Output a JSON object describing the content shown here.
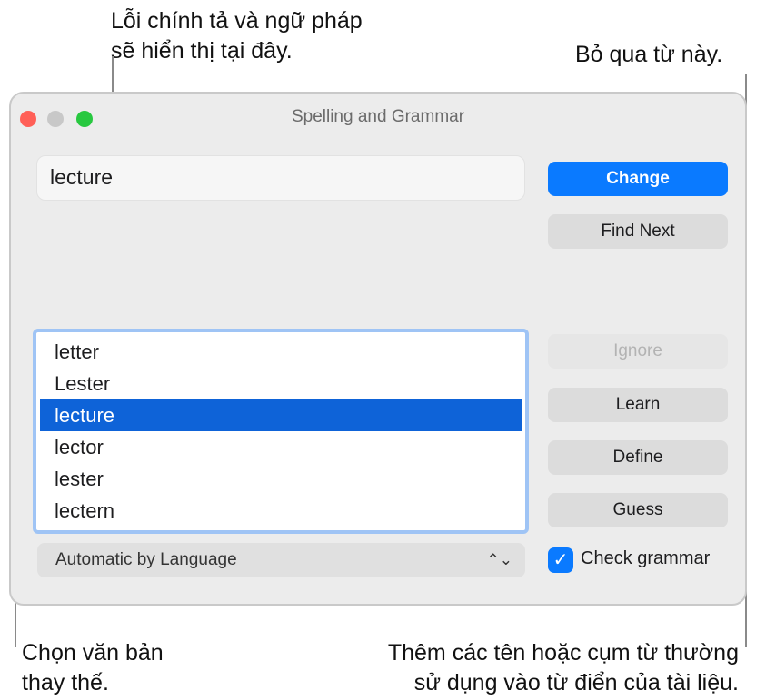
{
  "callouts": {
    "top_left_line1": "Lỗi chính tả và ngữ pháp",
    "top_left_line2": "sẽ hiển thị tại đây.",
    "top_right": "Bỏ qua từ này.",
    "bottom_left_line1": "Chọn văn bản",
    "bottom_left_line2": "thay thế.",
    "bottom_right_line1": "Thêm các tên hoặc cụm từ thường",
    "bottom_right_line2": "sử dụng vào từ điển của tài liệu."
  },
  "window": {
    "title": "Spelling and Grammar",
    "traffic_light_colors": {
      "close": "#ff5f57",
      "minimize": "#c8c8c8",
      "zoom": "#28c840"
    }
  },
  "misspelled_word": "lecture",
  "suggestions": [
    {
      "label": "letter",
      "selected": false
    },
    {
      "label": "Lester",
      "selected": false
    },
    {
      "label": "lecture",
      "selected": true
    },
    {
      "label": "lector",
      "selected": false
    },
    {
      "label": "lester",
      "selected": false
    },
    {
      "label": "lectern",
      "selected": false
    }
  ],
  "language_select": {
    "value": "Automatic by Language",
    "icon": "chevron-updown-icon"
  },
  "buttons": {
    "change": "Change",
    "find_next": "Find Next",
    "ignore": "Ignore",
    "learn": "Learn",
    "define": "Define",
    "guess": "Guess"
  },
  "check_grammar": {
    "label": "Check grammar",
    "checked": true
  },
  "colors": {
    "accent": "#0a7aff",
    "selection": "#0e63d8",
    "focus_ring": "#9fc4f5"
  }
}
